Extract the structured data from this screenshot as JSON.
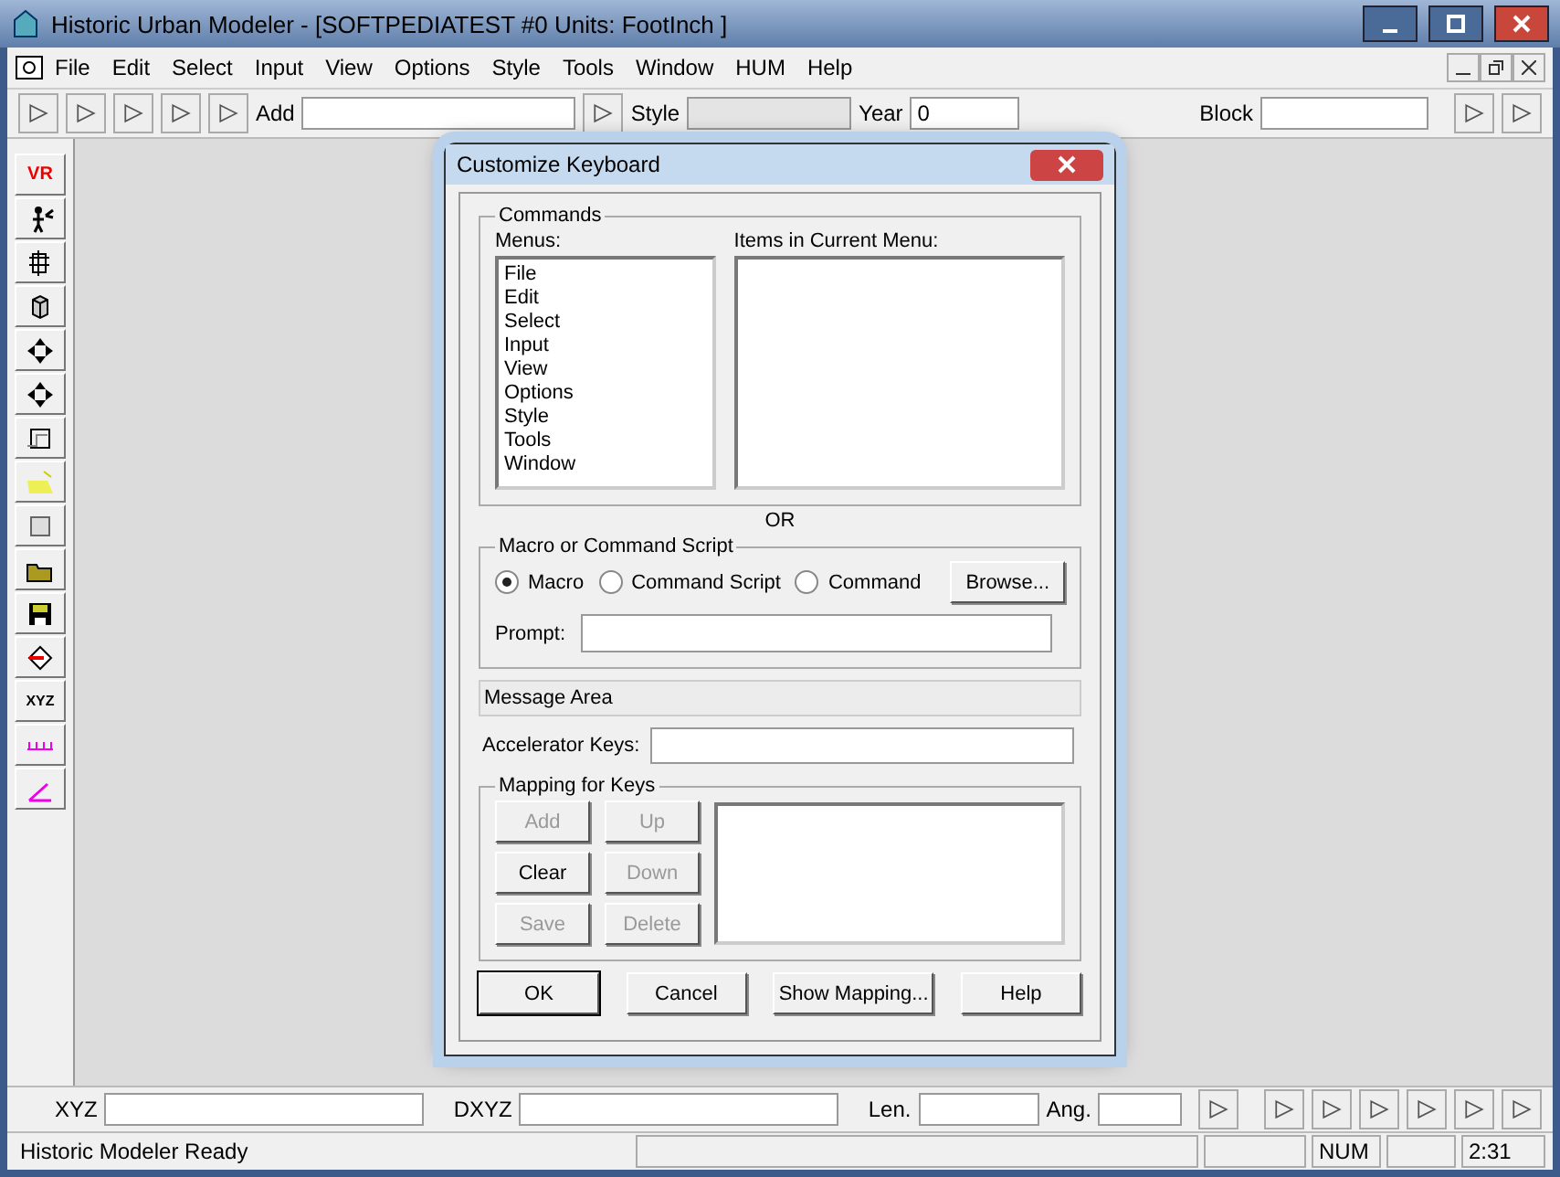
{
  "window": {
    "title": "Historic Urban Modeler - [SOFTPEDIATEST #0  Units: FootInch ]"
  },
  "menu_bar": [
    "File",
    "Edit",
    "Select",
    "Input",
    "View",
    "Options",
    "Style",
    "Tools",
    "Window",
    "HUM",
    "Help"
  ],
  "toolbar": {
    "add_label": "Add",
    "style_label": "Style",
    "year_label": "Year",
    "year_value": "0",
    "block_label": "Block"
  },
  "left_toolbar": [
    {
      "kind": "text",
      "label": "VR"
    },
    {
      "kind": "icon"
    },
    {
      "kind": "icon"
    },
    {
      "kind": "icon"
    },
    {
      "kind": "icon"
    },
    {
      "kind": "icon"
    },
    {
      "kind": "icon"
    },
    {
      "kind": "icon"
    },
    {
      "kind": "icon"
    },
    {
      "kind": "icon"
    },
    {
      "kind": "icon"
    },
    {
      "kind": "icon"
    },
    {
      "kind": "text",
      "label": "XYZ"
    },
    {
      "kind": "icon"
    },
    {
      "kind": "icon"
    }
  ],
  "dialog": {
    "title": "Customize Keyboard",
    "commands": {
      "legend": "Commands",
      "menus_label": "Menus:",
      "items_label": "Items in Current Menu:",
      "menus": [
        "File",
        "Edit",
        "Select",
        "Input",
        "View",
        "Options",
        "Style",
        "Tools",
        "Window"
      ]
    },
    "or_label": "OR",
    "macro": {
      "legend": "Macro or Command Script",
      "options": [
        {
          "label": "Macro",
          "selected": true
        },
        {
          "label": "Command Script",
          "selected": false
        },
        {
          "label": "Command",
          "selected": false
        }
      ],
      "browse": "Browse...",
      "prompt_label": "Prompt:"
    },
    "message_area": "Message Area",
    "accelerator_label": "Accelerator Keys:",
    "mapping": {
      "legend": "Mapping for Keys",
      "buttons": [
        {
          "label": "Add",
          "disabled": true
        },
        {
          "label": "Up",
          "disabled": true
        },
        {
          "label": "Clear",
          "disabled": false
        },
        {
          "label": "Down",
          "disabled": true
        },
        {
          "label": "Save",
          "disabled": true
        },
        {
          "label": "Delete",
          "disabled": true
        }
      ]
    },
    "buttons": [
      "OK",
      "Cancel",
      "Show Mapping...",
      "Help"
    ]
  },
  "coord_bar": {
    "xyz_label": "XYZ",
    "dxyz_label": "DXYZ",
    "len_label": "Len.",
    "ang_label": "Ang."
  },
  "status_bar": {
    "message": "Historic Modeler Ready",
    "num": "NUM",
    "time": "2:31"
  }
}
